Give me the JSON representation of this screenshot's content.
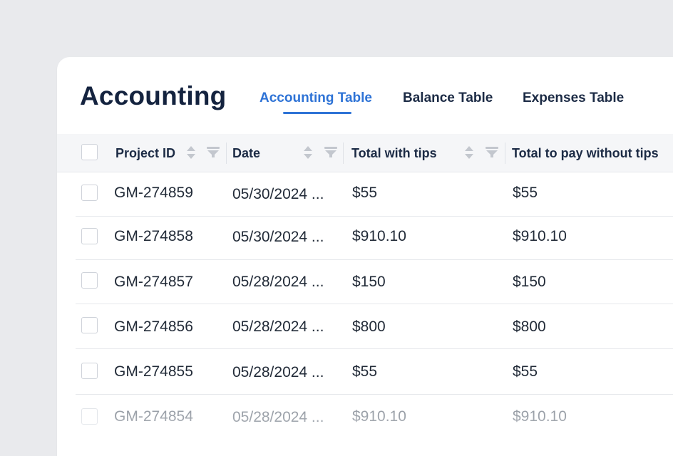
{
  "page_title": "Accounting",
  "tabs": [
    {
      "label": "Accounting Table",
      "active": true
    },
    {
      "label": "Balance Table",
      "active": false
    },
    {
      "label": "Expenses Table",
      "active": false
    }
  ],
  "colors": {
    "accent": "#2e73d6",
    "title": "#14233f",
    "text": "#222b38",
    "background": "#e9eaed"
  },
  "table": {
    "columns": [
      "Project ID",
      "Date",
      "Total with tips",
      "Total to pay without tips"
    ],
    "rows": [
      {
        "project_id": "GM-274859",
        "date": "05/30/2024 ...",
        "total_with_tips": "$55",
        "total_without_tips": "$55"
      },
      {
        "project_id": "GM-274858",
        "date": "05/30/2024 ...",
        "total_with_tips": "$910.10",
        "total_without_tips": "$910.10"
      },
      {
        "project_id": "GM-274857",
        "date": "05/28/2024 ...",
        "total_with_tips": "$150",
        "total_without_tips": "$150"
      },
      {
        "project_id": "GM-274856",
        "date": "05/28/2024 ...",
        "total_with_tips": "$800",
        "total_without_tips": "$800"
      },
      {
        "project_id": "GM-274855",
        "date": "05/28/2024 ...",
        "total_with_tips": "$55",
        "total_without_tips": "$55"
      },
      {
        "project_id": "GM-274854",
        "date": "05/28/2024 ...",
        "total_with_tips": "$910.10",
        "total_without_tips": "$910.10"
      }
    ]
  }
}
